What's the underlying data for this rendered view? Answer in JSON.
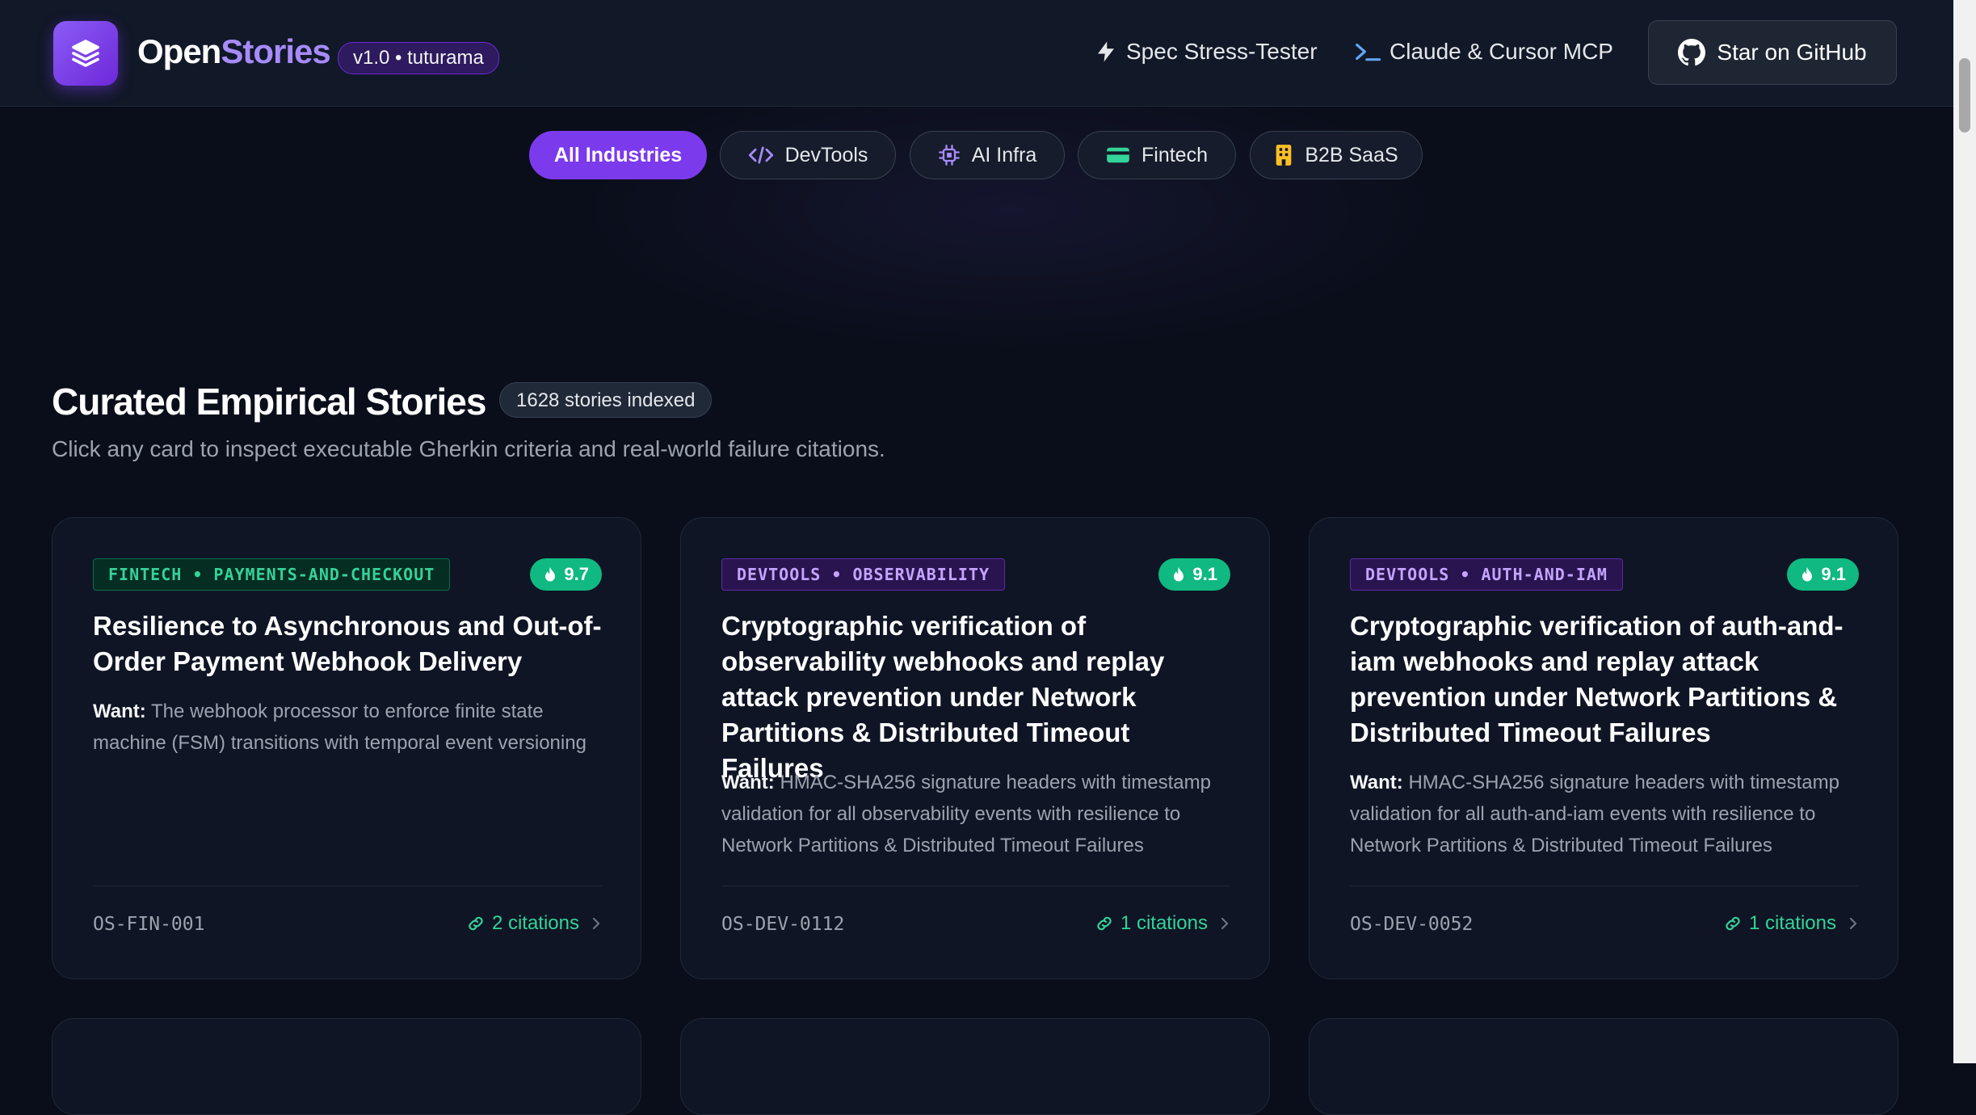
{
  "header": {
    "brand_part1": "Open",
    "brand_part2": "Stories",
    "version_badge": "v1.0 • tuturama",
    "nav": [
      {
        "label": "Spec Stress-Tester",
        "icon": "lightning-icon"
      },
      {
        "label": "Claude & Cursor MCP",
        "icon": "terminal-icon"
      }
    ],
    "github_button": "Star on GitHub"
  },
  "filters": [
    {
      "label": "All Industries",
      "active": true
    },
    {
      "label": "DevTools",
      "icon": "code-icon",
      "icon_color": "#a78bfa"
    },
    {
      "label": "AI Infra",
      "icon": "chip-icon",
      "icon_color": "#a78bfa"
    },
    {
      "label": "Fintech",
      "icon": "credit-card-icon",
      "icon_color": "#34d399"
    },
    {
      "label": "B2B SaaS",
      "icon": "building-icon",
      "icon_color": "#fbbf24"
    }
  ],
  "section": {
    "title": "Curated Empirical Stories",
    "count_badge": "1628 stories indexed",
    "subtitle": "Click any card to inspect executable Gherkin criteria and real-world failure citations."
  },
  "cards": [
    {
      "tag": "FINTECH • PAYMENTS-AND-CHECKOUT",
      "tag_color": "green",
      "score": "9.7",
      "title": "Resilience to Asynchronous and Out-of-Order Payment Webhook Delivery",
      "want_label": "Want:",
      "want": "The webhook processor to enforce finite state machine (FSM) transitions with temporal event versioning",
      "id": "OS-FIN-001",
      "citations": "2 citations"
    },
    {
      "tag": "DEVTOOLS • OBSERVABILITY",
      "tag_color": "purple",
      "score": "9.1",
      "title": "Cryptographic verification of observability webhooks and replay attack prevention under Network Partitions & Distributed Timeout Failures",
      "want_label": "Want:",
      "want": "HMAC-SHA256 signature headers with timestamp validation for all observability events with resilience to Network Partitions & Distributed Timeout Failures",
      "id": "OS-DEV-0112",
      "citations": "1 citations"
    },
    {
      "tag": "DEVTOOLS • AUTH-AND-IAM",
      "tag_color": "purple",
      "score": "9.1",
      "title": "Cryptographic verification of auth-and-iam webhooks and replay attack prevention under Network Partitions & Distributed Timeout Failures",
      "want_label": "Want:",
      "want": "HMAC-SHA256 signature headers with timestamp validation for all auth-and-iam events with resilience to Network Partitions & Distributed Timeout Failures",
      "id": "OS-DEV-0052",
      "citations": "1 citations"
    }
  ],
  "colors": {
    "accent": "#7c3aed",
    "brand_highlight": "#a78bfa",
    "score_green": "#10b981",
    "citation_green": "#34d399"
  }
}
